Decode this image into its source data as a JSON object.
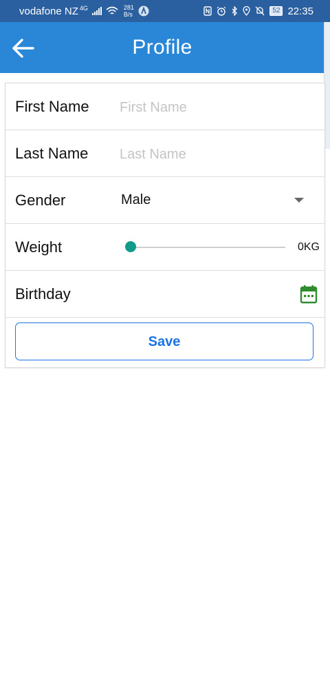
{
  "status_bar": {
    "carrier": "vodafone NZ",
    "network_type": "4G",
    "net_speed_value": "281",
    "net_speed_unit": "B/s",
    "battery": "52",
    "time": "22:35"
  },
  "app_bar": {
    "title": "Profile",
    "back_icon": "arrow-left-icon"
  },
  "form": {
    "first_name": {
      "label": "First Name",
      "value": "",
      "placeholder": "First Name"
    },
    "last_name": {
      "label": "Last Name",
      "value": "",
      "placeholder": "Last Name"
    },
    "gender": {
      "label": "Gender",
      "selected": "Male"
    },
    "weight": {
      "label": "Weight",
      "value_text": "0KG",
      "slider_fraction": 0
    },
    "birthday": {
      "label": "Birthday",
      "icon": "calendar-icon"
    },
    "save_label": "Save"
  },
  "colors": {
    "status_bar": "#2a5fa0",
    "app_bar": "#2a87d8",
    "slider_thumb": "#129a8c",
    "calendar_icon": "#2e8b2e",
    "save_accent": "#1a73e8"
  }
}
